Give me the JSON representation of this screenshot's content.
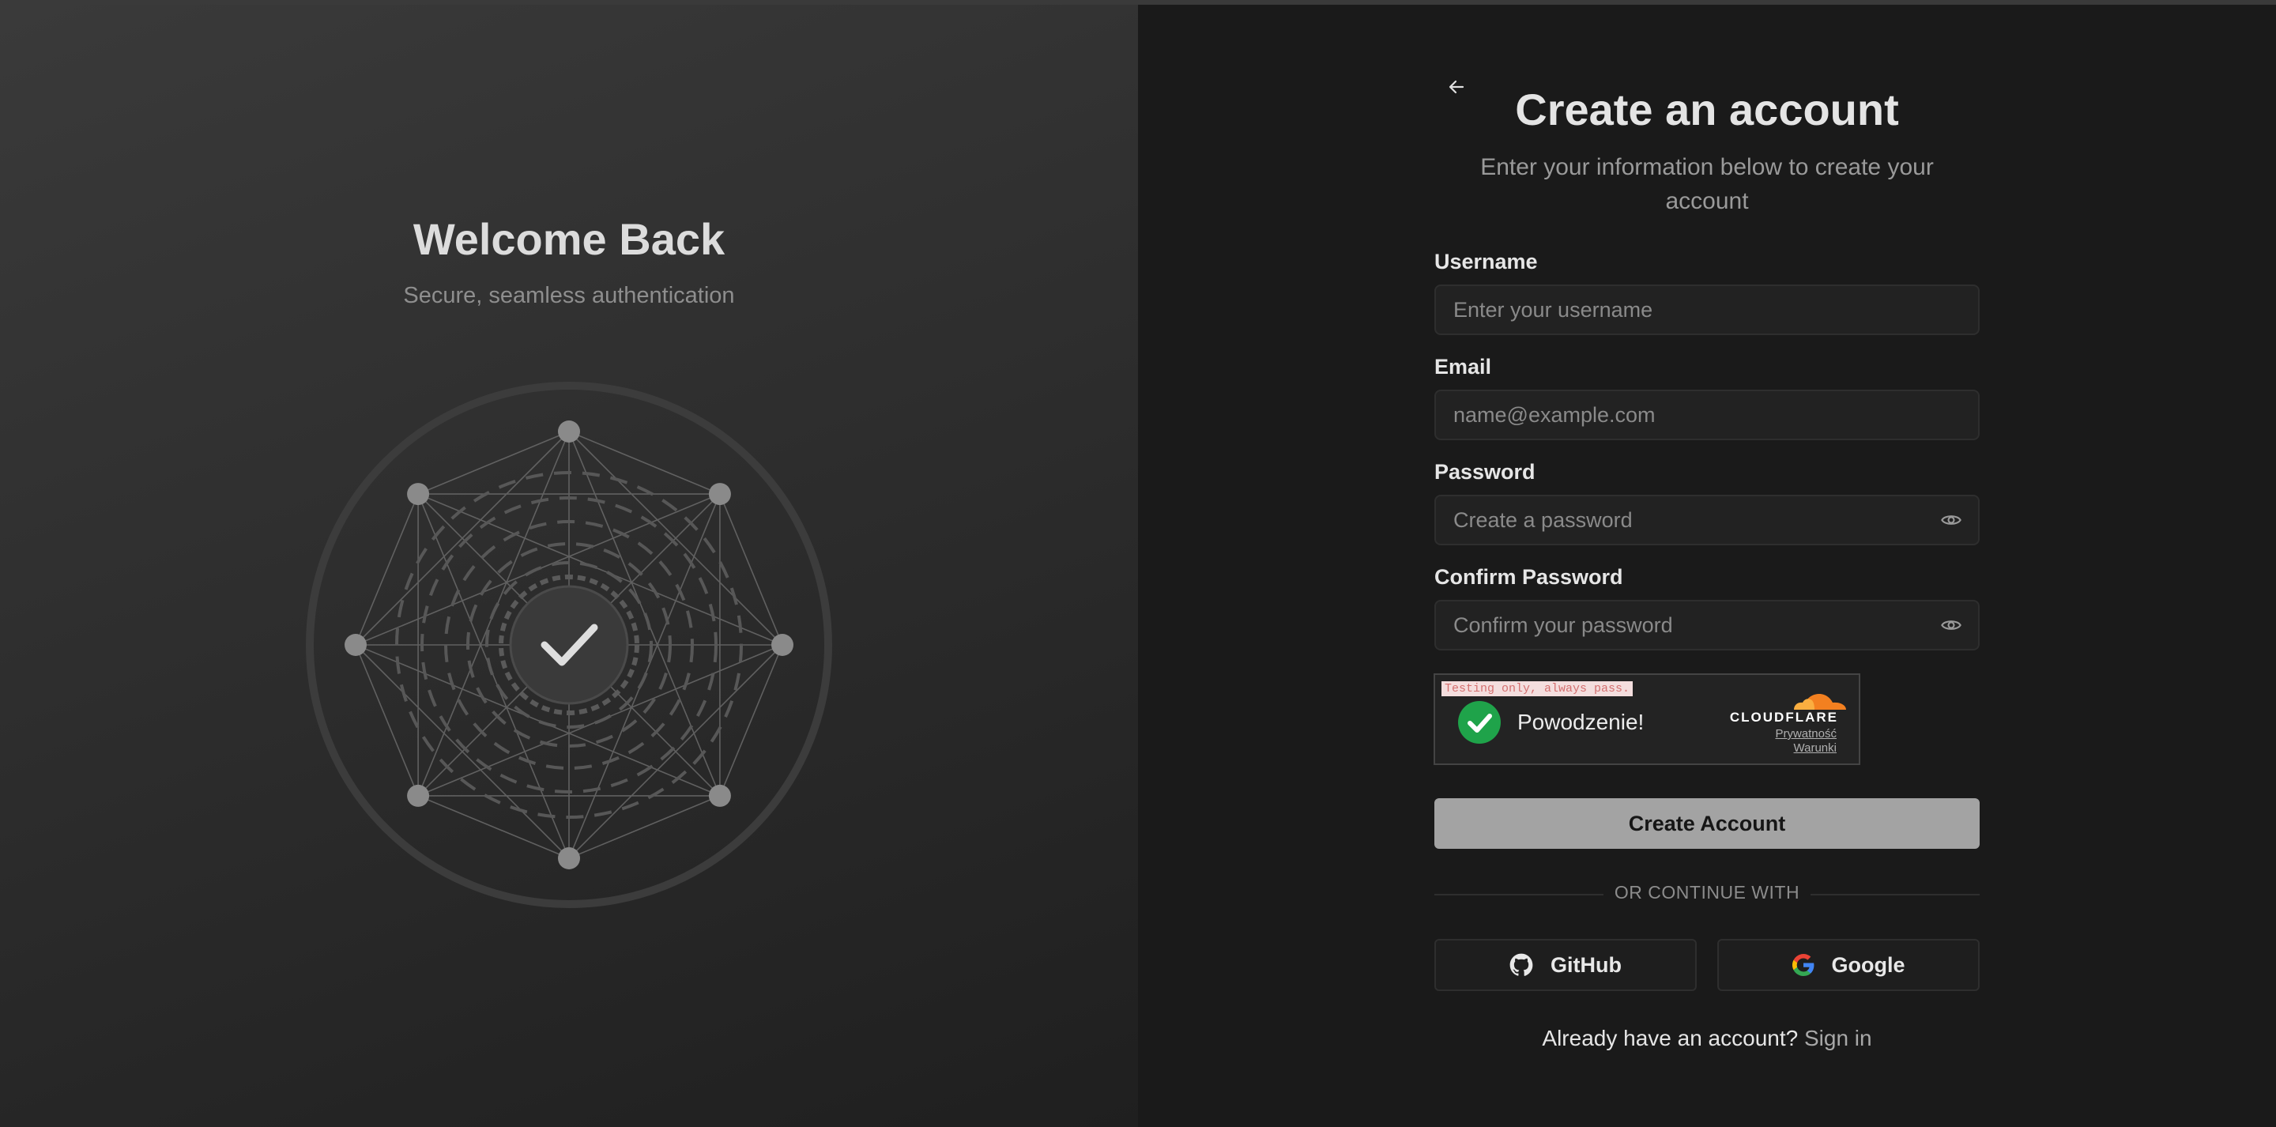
{
  "left": {
    "title": "Welcome Back",
    "subtitle": "Secure, seamless authentication"
  },
  "form": {
    "title": "Create an account",
    "subtitle": "Enter your information below to create your account",
    "fields": {
      "username": {
        "label": "Username",
        "placeholder": "Enter your username",
        "value": ""
      },
      "email": {
        "label": "Email",
        "placeholder": "name@example.com",
        "value": ""
      },
      "password": {
        "label": "Password",
        "placeholder": "Create a password",
        "value": ""
      },
      "confirm": {
        "label": "Confirm Password",
        "placeholder": "Confirm your password",
        "value": ""
      }
    },
    "captcha": {
      "test_notice": "Testing only, always pass.",
      "status": "Powodzenie!",
      "brand": "CLOUDFLARE",
      "privacy": "Prywatność",
      "terms": "Warunki"
    },
    "submit_label": "Create Account",
    "divider": "OR CONTINUE WITH",
    "social": {
      "github": "GitHub",
      "google": "Google"
    },
    "footer_prompt": "Already have an account?",
    "signin": "Sign in"
  },
  "icons": {
    "back": "arrow-left-icon",
    "eye": "eye-icon",
    "check": "checkmark-icon",
    "github": "github-icon",
    "google": "google-icon",
    "cloudflare": "cloudflare-logo"
  },
  "colors": {
    "captcha_success": "#1fa34a",
    "cloudflare_orange": "#f38020",
    "primary_button": "#a3a3a3"
  }
}
